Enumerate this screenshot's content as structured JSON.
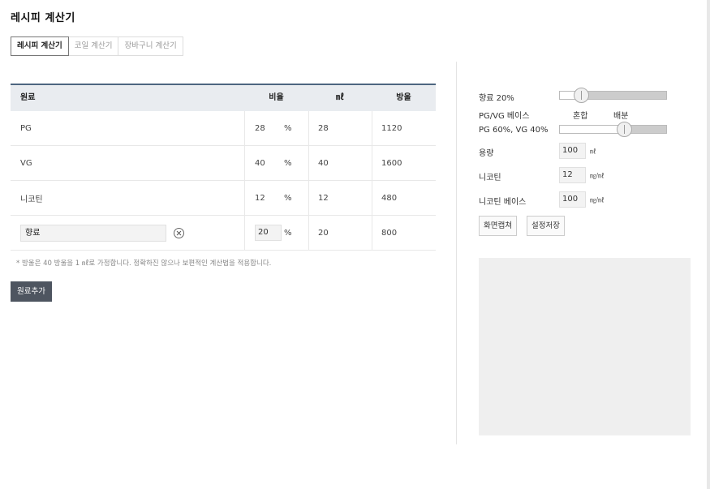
{
  "page": {
    "title": "레시피 계산기"
  },
  "tabs": [
    {
      "label": "레시피 계산기",
      "active": true
    },
    {
      "label": "코일 계산기",
      "active": false
    },
    {
      "label": "장바구니 계산기",
      "active": false
    }
  ],
  "table": {
    "headers": {
      "ingredient": "원료",
      "ratio": "비율",
      "ml": "㎖",
      "drops": "방울"
    },
    "rows": [
      {
        "name": "PG",
        "ratio": "28",
        "unit": "%",
        "ml": "28",
        "drops": "1120"
      },
      {
        "name": "VG",
        "ratio": "40",
        "unit": "%",
        "ml": "40",
        "drops": "1600"
      },
      {
        "name": "니코틴",
        "ratio": "12",
        "unit": "%",
        "ml": "12",
        "drops": "480"
      },
      {
        "name": "향료",
        "ratio": "20",
        "unit": "%",
        "ml": "20",
        "drops": "800",
        "editable": true
      }
    ]
  },
  "note": "* 방울은 40 방울을 1 ㎖로 가정합니다. 정확하진 않으나 보편적인 계산법을 적용합니다.",
  "add_button": "원료추가",
  "settings": {
    "flavor_label": "향료 20%",
    "flavor_level_pct": 20,
    "base_label": "PG/VG 베이스",
    "base_mix": "혼합",
    "base_split": "배분",
    "base_ratio_label": "PG 60%, VG 40%",
    "base_level_pct": 60,
    "volume_label": "용량",
    "volume_value": "100",
    "volume_unit": "㎖",
    "nicotine_label": "니코틴",
    "nicotine_value": "12",
    "nicotine_unit": "㎎/㎖",
    "nicotine_base_label": "니코틴 베이스",
    "nicotine_base_value": "100",
    "nicotine_base_unit": "㎎/㎖",
    "capture_button": "화면캡쳐",
    "save_button": "설정저장"
  }
}
